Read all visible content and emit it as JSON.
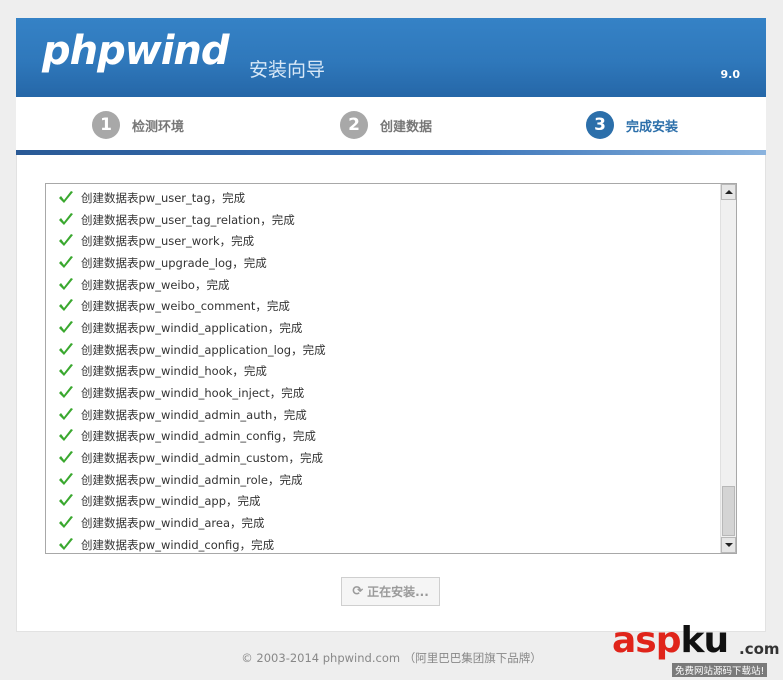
{
  "header": {
    "logo": "phpwind",
    "subtitle": "安装向导",
    "version": "9.0"
  },
  "steps": [
    {
      "num": "1",
      "label": "检测环境",
      "active": false
    },
    {
      "num": "2",
      "label": "创建数据",
      "active": false
    },
    {
      "num": "3",
      "label": "完成安装",
      "active": true
    }
  ],
  "log": {
    "items": [
      "创建数据表pw_user_tag，完成",
      "创建数据表pw_user_tag_relation，完成",
      "创建数据表pw_user_work，完成",
      "创建数据表pw_upgrade_log，完成",
      "创建数据表pw_weibo，完成",
      "创建数据表pw_weibo_comment，完成",
      "创建数据表pw_windid_application，完成",
      "创建数据表pw_windid_application_log，完成",
      "创建数据表pw_windid_hook，完成",
      "创建数据表pw_windid_hook_inject，完成",
      "创建数据表pw_windid_admin_auth，完成",
      "创建数据表pw_windid_admin_config，完成",
      "创建数据表pw_windid_admin_custom，完成",
      "创建数据表pw_windid_admin_role，完成",
      "创建数据表pw_windid_app，完成",
      "创建数据表pw_windid_area，完成",
      "创建数据表pw_windid_config，完成"
    ]
  },
  "install_button": {
    "icon": "refresh-icon",
    "label": "正在安装..."
  },
  "footer": {
    "copyright": "© 2003-2014 phpwind.com （阿里巴巴集团旗下品牌）"
  },
  "watermark": {
    "brand_red": "asp",
    "brand_black": "ku",
    "domain": ".com",
    "tagline": "免费网站源码下载站!"
  },
  "colors": {
    "header_blue": "#2f78bb",
    "active_step": "#2c6faa",
    "check_green": "#3aa82f",
    "watermark_red": "#e0241a"
  }
}
